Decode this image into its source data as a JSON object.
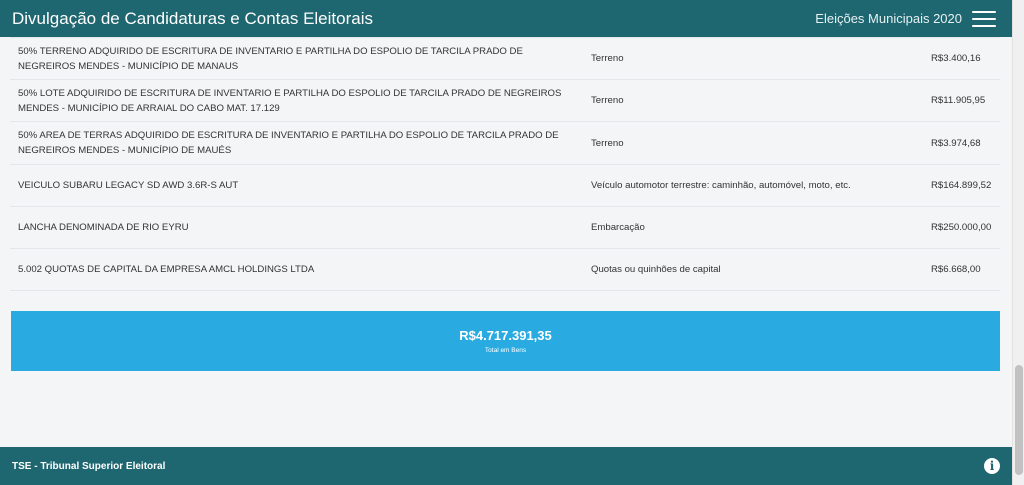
{
  "header": {
    "title": "Divulgação de Candidaturas e Contas Eleitorais",
    "election": "Eleições Municipais 2020",
    "menu_icon": "hamburger-menu-icon"
  },
  "assets": {
    "rows": [
      {
        "description": "50% TERRENO ADQUIRIDO DE ESCRITURA DE INVENTARIO E PARTILHA DO ESPOLIO DE TARCILA PRADO DE NEGREIROS MENDES - MUNICÍPIO DE MANAUS",
        "type": "Terreno",
        "value": "R$3.400,16"
      },
      {
        "description": "50% LOTE ADQUIRIDO DE ESCRITURA DE INVENTARIO E PARTILHA DO ESPOLIO DE TARCILA PRADO DE NEGREIROS MENDES - MUNICÍPIO DE ARRAIAL DO CABO MAT. 17.129",
        "type": "Terreno",
        "value": "R$11.905,95"
      },
      {
        "description": "50% AREA DE TERRAS ADQUIRIDO DE ESCRITURA DE INVENTARIO E PARTILHA DO ESPOLIO DE TARCILA PRADO DE NEGREIROS MENDES - MUNICÍPIO DE MAUÉS",
        "type": "Terreno",
        "value": "R$3.974,68"
      },
      {
        "description": "VEICULO SUBARU LEGACY SD AWD 3.6R-S AUT",
        "type": "Veículo automotor terrestre: caminhão, automóvel, moto, etc.",
        "value": "R$164.899,52"
      },
      {
        "description": "LANCHA DENOMINADA DE RIO EYRU",
        "type": "Embarcação",
        "value": "R$250.000,00"
      },
      {
        "description": "5.002 QUOTAS DE CAPITAL DA EMPRESA AMCL HOLDINGS LTDA",
        "type": "Quotas ou quinhões de capital",
        "value": "R$6.668,00"
      }
    ]
  },
  "total": {
    "amount": "R$4.717.391,35",
    "label": "Total em Bens"
  },
  "footer": {
    "brand": "TSE - Tribunal Superior Eleitoral",
    "info_icon": "info-icon"
  }
}
